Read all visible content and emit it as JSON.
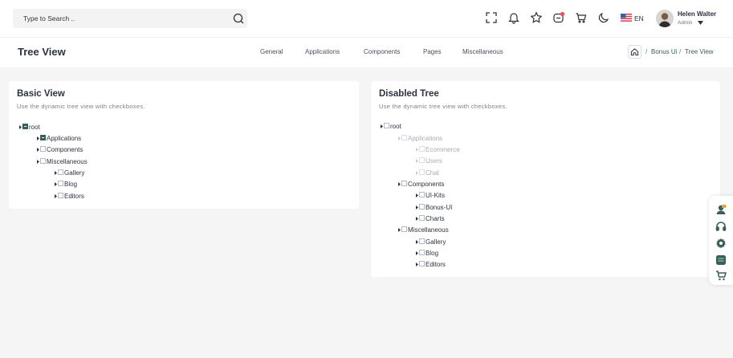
{
  "search": {
    "placeholder": "Type to Search .."
  },
  "header": {
    "language": "EN",
    "user": {
      "name": "Helen Walter",
      "role": "Admin"
    }
  },
  "page": {
    "title": "Tree View"
  },
  "nav": [
    "General",
    "Applications",
    "Components",
    "Pages",
    "Miscellaneous"
  ],
  "breadcrumb": {
    "parent": "Bonus Ui",
    "current": "Tree View",
    "separator": "/"
  },
  "cards": {
    "basic": {
      "title": "Basic View",
      "subtitle": "Use the dynamic tree view with checkboxes.",
      "nodes": [
        {
          "label": "root",
          "checked": true
        },
        {
          "label": "Applications",
          "checked": true
        },
        {
          "label": "Components",
          "checked": false
        },
        {
          "label": "Miscellaneous",
          "checked": false
        },
        {
          "label": "Gallery",
          "checked": false
        },
        {
          "label": "Blog",
          "checked": false
        },
        {
          "label": "Editors",
          "checked": false
        }
      ]
    },
    "disabled": {
      "title": "Disabled Tree",
      "subtitle": "Use the dynamic tree view with checkboxes.",
      "nodes": [
        {
          "label": "root",
          "disabled": false
        },
        {
          "label": "Applications",
          "disabled": true
        },
        {
          "label": "Ecommerce",
          "disabled": true
        },
        {
          "label": "Users",
          "disabled": true
        },
        {
          "label": "Chat",
          "disabled": true
        },
        {
          "label": "Components",
          "disabled": false
        },
        {
          "label": "UI-Kits",
          "disabled": false
        },
        {
          "label": "Bonus-UI",
          "disabled": false
        },
        {
          "label": "Charts",
          "disabled": false
        },
        {
          "label": "Miscellaneous",
          "disabled": false
        },
        {
          "label": "Gallery",
          "disabled": false
        },
        {
          "label": "Blog",
          "disabled": false
        },
        {
          "label": "Editors",
          "disabled": false
        }
      ]
    }
  },
  "icons": {
    "header": [
      "fullscreen-icon",
      "bell-icon",
      "star-icon",
      "messages-icon",
      "cart-icon",
      "moon-icon"
    ],
    "floating": [
      "user-chat-icon",
      "headset-icon",
      "gear-icon",
      "layout-icon",
      "shopping-cart-icon"
    ]
  },
  "colors": {
    "accent": "#3a5f5b",
    "notify": "#f34c5f",
    "page_bg": "#f5f5f5",
    "card_bg": "#ffffff"
  }
}
